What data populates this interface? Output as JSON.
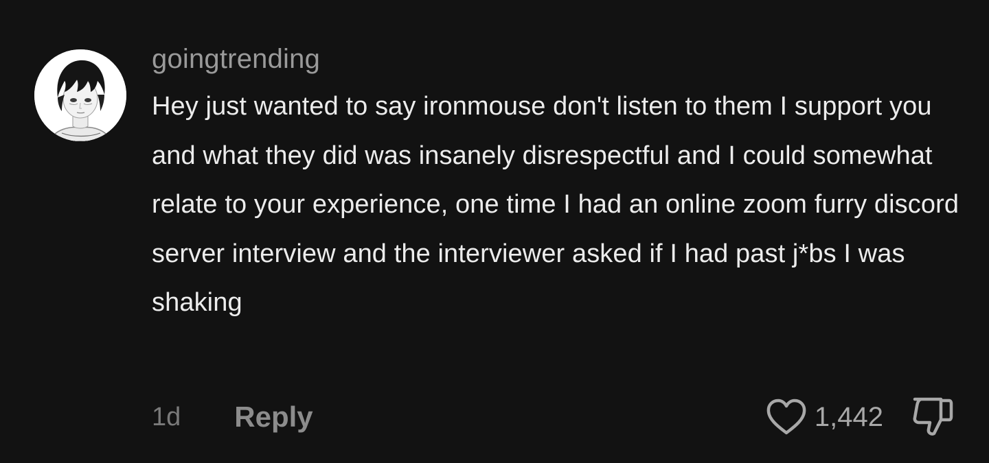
{
  "comment": {
    "username": "goingtrending",
    "text": "Hey just wanted to say ironmouse don't listen to them I support you and what they did was insanely disrespectful and I could somewhat relate to your experience, one time I had an online zoom furry discord server interview and the interviewer asked if I had past j*bs I was shaking",
    "timestamp": "1d",
    "reply_label": "Reply",
    "like_count": "1,442",
    "icons": {
      "like": "heart-outline-icon",
      "dislike": "thumbs-down-outline-icon"
    }
  },
  "colors": {
    "background": "#121212",
    "text": "#ececec",
    "username": "#9a9a9a",
    "muted": "#7a7a7a"
  }
}
